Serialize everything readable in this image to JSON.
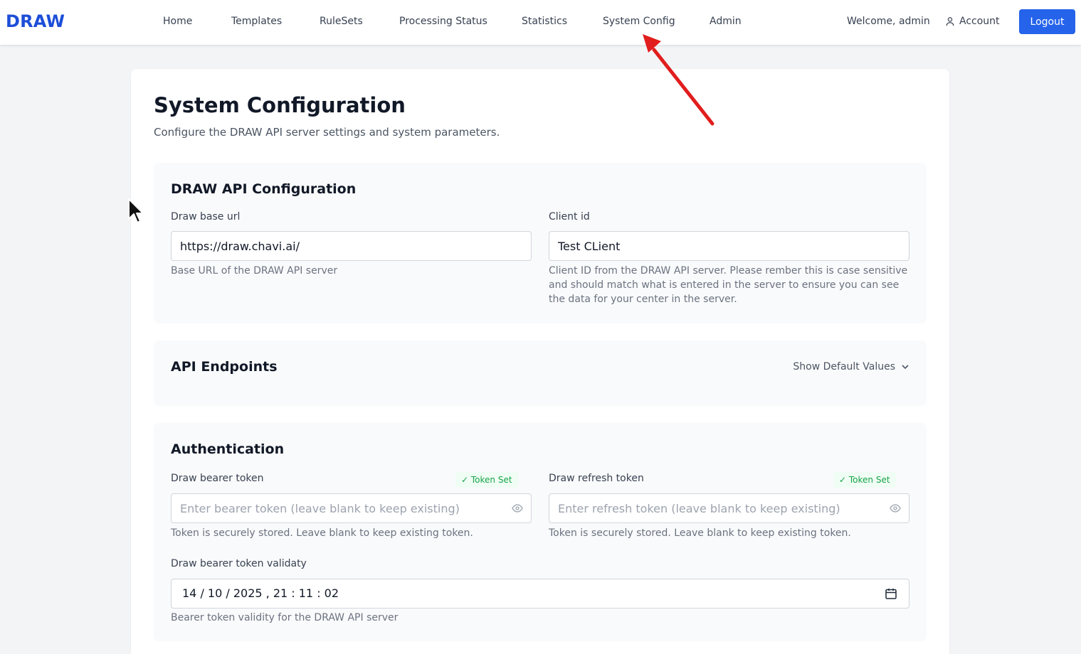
{
  "header": {
    "brand": "DRAW",
    "nav": [
      "Home",
      "Templates",
      "RuleSets",
      "Processing Status",
      "Statistics",
      "System Config",
      "Admin"
    ],
    "welcome": "Welcome, admin",
    "account_label": "Account",
    "logout_label": "Logout"
  },
  "page": {
    "title": "System Configuration",
    "subtitle": "Configure the DRAW API server settings and system parameters."
  },
  "api_config": {
    "title": "DRAW API Configuration",
    "base_url": {
      "label": "Draw base url",
      "value": "https://draw.chavi.ai/",
      "help": "Base URL of the DRAW API server"
    },
    "client_id": {
      "label": "Client id",
      "value": "Test CLient",
      "help": "Client ID from the DRAW API server. Please rember this is case sensitive and should match what is entered in the server to ensure you can see the data for your center in the server."
    }
  },
  "endpoints": {
    "title": "API Endpoints",
    "toggle_label": "Show Default Values"
  },
  "auth": {
    "title": "Authentication",
    "bearer": {
      "label": "Draw bearer token",
      "badge": "✓ Token Set",
      "placeholder": "Enter bearer token (leave blank to keep existing)",
      "help": "Token is securely stored. Leave blank to keep existing token."
    },
    "refresh": {
      "label": "Draw refresh token",
      "badge": "✓ Token Set",
      "placeholder": "Enter refresh token (leave blank to keep existing)",
      "help": "Token is securely stored. Leave blank to keep existing token."
    },
    "validity": {
      "label": "Draw bearer token validaty",
      "value": "14 / 10 / 2025 ,  21 : 11 : 02",
      "help": "Bearer token validity for the DRAW API server"
    }
  },
  "colors": {
    "brand": "#1d4ed8",
    "primary_button": "#2563eb",
    "badge_text": "#16a34a",
    "annotation_arrow": "#e11d1d"
  }
}
